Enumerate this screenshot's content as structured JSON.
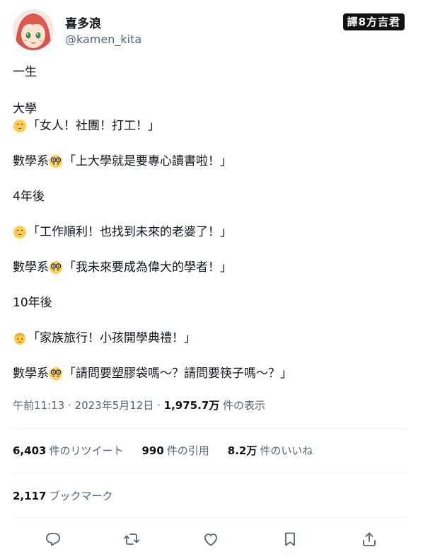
{
  "author": {
    "display_name": "喜多浪",
    "handle": "@kamen_kita"
  },
  "credit": "譯8方吉君",
  "tweet": {
    "lines": [
      {
        "text": "一生"
      },
      {
        "text": "大學"
      },
      {
        "emoji": "grinning-face-icon",
        "text": "「女人！社團！打工！」"
      },
      {
        "prefix": "數學系",
        "emoji": "nerd-face-icon",
        "text": "「上大學就是要專心讀書啦！」"
      },
      {
        "text": "4年後"
      },
      {
        "emoji": "grinning-face-icon",
        "text": "「工作順利！也找到未來的老婆了！」"
      },
      {
        "prefix": "數學系",
        "emoji": "nerd-face-icon",
        "text": "「我未來要成為偉大的學者！」"
      },
      {
        "text": "10年後"
      },
      {
        "emoji": "older-man-icon",
        "text": "「家族旅行！小孩開學典禮！」"
      },
      {
        "prefix": "數學系",
        "emoji": "nerd-face-icon",
        "text": "「請問要塑膠袋嗎～？請問要筷子嗎～？」"
      }
    ]
  },
  "meta": {
    "time": "午前11:13",
    "sep1": " · ",
    "date": "2023年5月12日",
    "sep2": " · ",
    "views_count": "1,975.7万",
    "views_label": " 件の表示"
  },
  "stats": {
    "retweets_count": "6,403",
    "retweets_label": "件のリツイート",
    "quotes_count": "990",
    "quotes_label": "件の引用",
    "likes_count": "8.2万",
    "likes_label": "件のいいね"
  },
  "bookmarks": {
    "count": "2,117",
    "label": "ブックマーク"
  },
  "actions": [
    "reply-icon",
    "retweet-icon",
    "like-icon",
    "bookmark-icon",
    "share-icon"
  ],
  "colors": {
    "text": "#0f1419",
    "secondary": "#536471",
    "divider": "#eff3f4",
    "avatar_hair": "#d9534a"
  }
}
